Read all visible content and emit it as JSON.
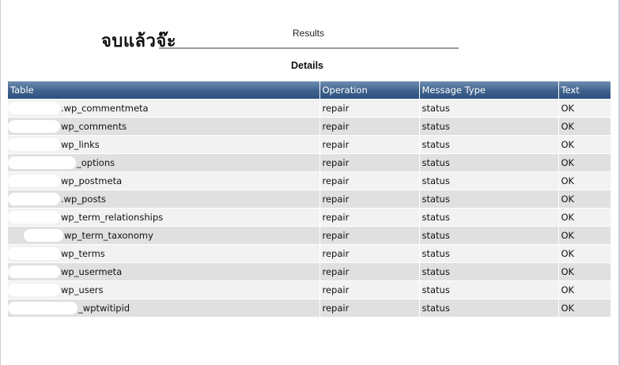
{
  "overlay": {
    "handwritten_text": "จบแล้วจ๊ะ"
  },
  "header": {
    "results_title": "Results",
    "details_title": "Details"
  },
  "table": {
    "columns": [
      "Table",
      "Operation",
      "Message Type",
      "Text"
    ],
    "rows": [
      {
        "table": ".wp_commentmeta",
        "operation": "repair",
        "message_type": "status",
        "text": "OK"
      },
      {
        "table": "wp_comments",
        "operation": "repair",
        "message_type": "status",
        "text": "OK"
      },
      {
        "table": "wp_links",
        "operation": "repair",
        "message_type": "status",
        "text": "OK"
      },
      {
        "table": "_options",
        "operation": "repair",
        "message_type": "status",
        "text": "OK"
      },
      {
        "table": "wp_postmeta",
        "operation": "repair",
        "message_type": "status",
        "text": "OK"
      },
      {
        "table": ".wp_posts",
        "operation": "repair",
        "message_type": "status",
        "text": "OK"
      },
      {
        "table": "wp_term_relationships",
        "operation": "repair",
        "message_type": "status",
        "text": "OK"
      },
      {
        "table": "wp_term_taxonomy",
        "operation": "repair",
        "message_type": "status",
        "text": "OK"
      },
      {
        "table": "wp_terms",
        "operation": "repair",
        "message_type": "status",
        "text": "OK"
      },
      {
        "table": "wp_usermeta",
        "operation": "repair",
        "message_type": "status",
        "text": "OK"
      },
      {
        "table": "wp_users",
        "operation": "repair",
        "message_type": "status",
        "text": "OK"
      },
      {
        "table": "_wptwitipid",
        "operation": "repair",
        "message_type": "status",
        "text": "OK"
      }
    ]
  }
}
